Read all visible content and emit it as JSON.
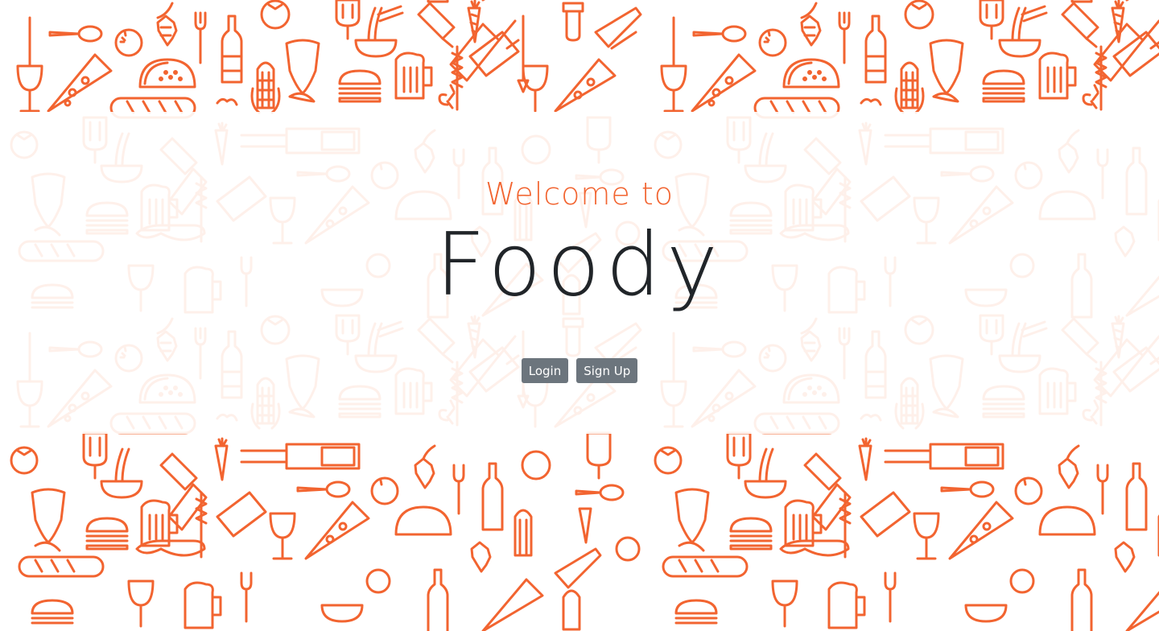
{
  "hero": {
    "welcome_text": "Welcome to",
    "brand_name": "Foody"
  },
  "actions": {
    "login_label": "Login",
    "signup_label": "Sign Up"
  },
  "colors": {
    "accent": "#f26430",
    "brand_text": "#212529",
    "button_bg": "#6c757d",
    "background": "#ffffff"
  },
  "pattern": {
    "icons": [
      "fork-icon",
      "knife-icon",
      "spoon-icon",
      "wine-glass-icon",
      "bottle-icon",
      "beer-mug-icon",
      "pizza-slice-icon",
      "taco-icon",
      "burger-icon",
      "noodle-bowl-icon",
      "carrot-icon",
      "tomato-icon",
      "orange-icon",
      "corn-icon",
      "fish-icon",
      "popsicle-icon",
      "cleaver-icon",
      "hop-icon",
      "baguette-icon",
      "sausage-icon"
    ]
  }
}
